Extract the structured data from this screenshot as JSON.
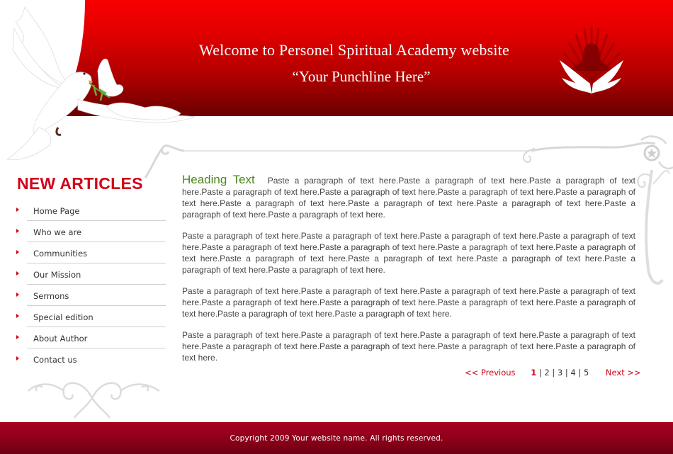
{
  "header": {
    "title": "Welcome to Personel Spiritual Academy website",
    "punchline": "“Your Punchline Here”",
    "colors": {
      "top": "#f80000",
      "bottom": "#6a0000"
    }
  },
  "sidebar": {
    "title": "NEW ARTICLES",
    "items": [
      {
        "label": "Home Page"
      },
      {
        "label": "Who we are"
      },
      {
        "label": "Communities"
      },
      {
        "label": "Our Mission"
      },
      {
        "label": "Sermons"
      },
      {
        "label": "Special edition"
      },
      {
        "label": "About Author"
      },
      {
        "label": "Contact us"
      }
    ]
  },
  "content": {
    "heading": "Heading Text",
    "paragraphs": [
      "Paste a paragraph of text here.Paste a paragraph of text here.Paste a paragraph of text here.Paste a paragraph of text here.Paste a paragraph of text here.Paste a paragraph of text here.Paste a paragraph of text here.Paste a paragraph of text here.Paste a paragraph of text here.Paste a paragraph of text here.Paste a paragraph of text here.Paste a paragraph of text here.",
      "Paste a paragraph of text here.Paste a paragraph of text here.Paste a paragraph of text here.Paste a paragraph of text here.Paste a paragraph of text here.Paste a paragraph of text here.Paste a paragraph of text here.Paste a paragraph of text here.Paste a paragraph of text here.Paste a paragraph of text here.Paste a paragraph of text here.Paste a paragraph of text here.Paste a paragraph of text here.",
      "Paste a paragraph of text here.Paste a paragraph of text here.Paste a paragraph of text here.Paste a paragraph of text here.Paste a paragraph of text here.Paste a paragraph of text here.Paste a paragraph of text here.Paste a paragraph of text here.Paste a paragraph of text here.Paste a paragraph of text here.",
      "Paste a paragraph of text here.Paste a paragraph of text here.Paste a paragraph of text here.Paste a paragraph of text here.Paste a paragraph of text here.Paste a paragraph of text here.Paste a paragraph of text here.Paste a paragraph of text here."
    ]
  },
  "pagination": {
    "previous": "<< Previous",
    "next": "Next >>",
    "pages": [
      "1",
      "2",
      "3",
      "4",
      "5"
    ],
    "current": "1",
    "separator": "|"
  },
  "footer": {
    "copyright": "Copyright 2009 Your website name. All rights reserved."
  },
  "theme": {
    "accent": "#d0021b",
    "heading_green": "#4a8a1c",
    "footer_red": "#8a0019"
  }
}
